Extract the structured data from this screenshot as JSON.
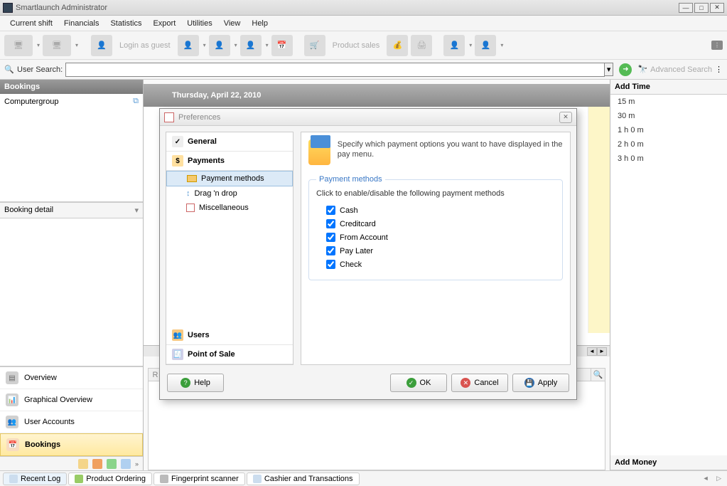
{
  "app": {
    "title": "Smartlaunch Administrator"
  },
  "menu": [
    "Current shift",
    "Financials",
    "Statistics",
    "Export",
    "Utilities",
    "View",
    "Help"
  ],
  "toolbar": {
    "login_guest": "Login as guest",
    "product_sales": "Product sales"
  },
  "search": {
    "label": "User Search:",
    "advanced": "Advanced Search",
    "value": ""
  },
  "left": {
    "header": "Bookings",
    "group_label": "Computergroup",
    "detail_label": "Booking detail",
    "nav": [
      "Overview",
      "Graphical Overview",
      "User Accounts",
      "Bookings"
    ],
    "active_nav_index": 3
  },
  "center": {
    "date": "Thursday, April 22, 2010"
  },
  "right": {
    "header": "Add Time",
    "items": [
      "15 m",
      "30 m",
      "1 h 0 m",
      "2 h 0 m",
      "3 h 0 m"
    ],
    "footer": "Add Money"
  },
  "modal": {
    "title": "Preferences",
    "categories": {
      "general": "General",
      "payments": "Payments",
      "users": "Users",
      "pos": "Point of Sale"
    },
    "subs": [
      "Payment methods",
      "Drag 'n drop",
      "Miscellaneous"
    ],
    "active_sub_index": 0,
    "description": "Specify which payment options you want to have displayed in the pay menu.",
    "fieldset_title": "Payment methods",
    "hint": "Click to enable/disable the following payment methods",
    "methods": [
      {
        "label": "Cash",
        "checked": true
      },
      {
        "label": "Creditcard",
        "checked": true
      },
      {
        "label": "From Account",
        "checked": true
      },
      {
        "label": "Pay Later",
        "checked": true
      },
      {
        "label": "Check",
        "checked": true
      }
    ],
    "buttons": {
      "help": "Help",
      "ok": "OK",
      "cancel": "Cancel",
      "apply": "Apply"
    }
  },
  "tabs": [
    "Recent Log",
    "Product Ordering",
    "Fingerprint scanner",
    "Cashier and Transactions"
  ]
}
